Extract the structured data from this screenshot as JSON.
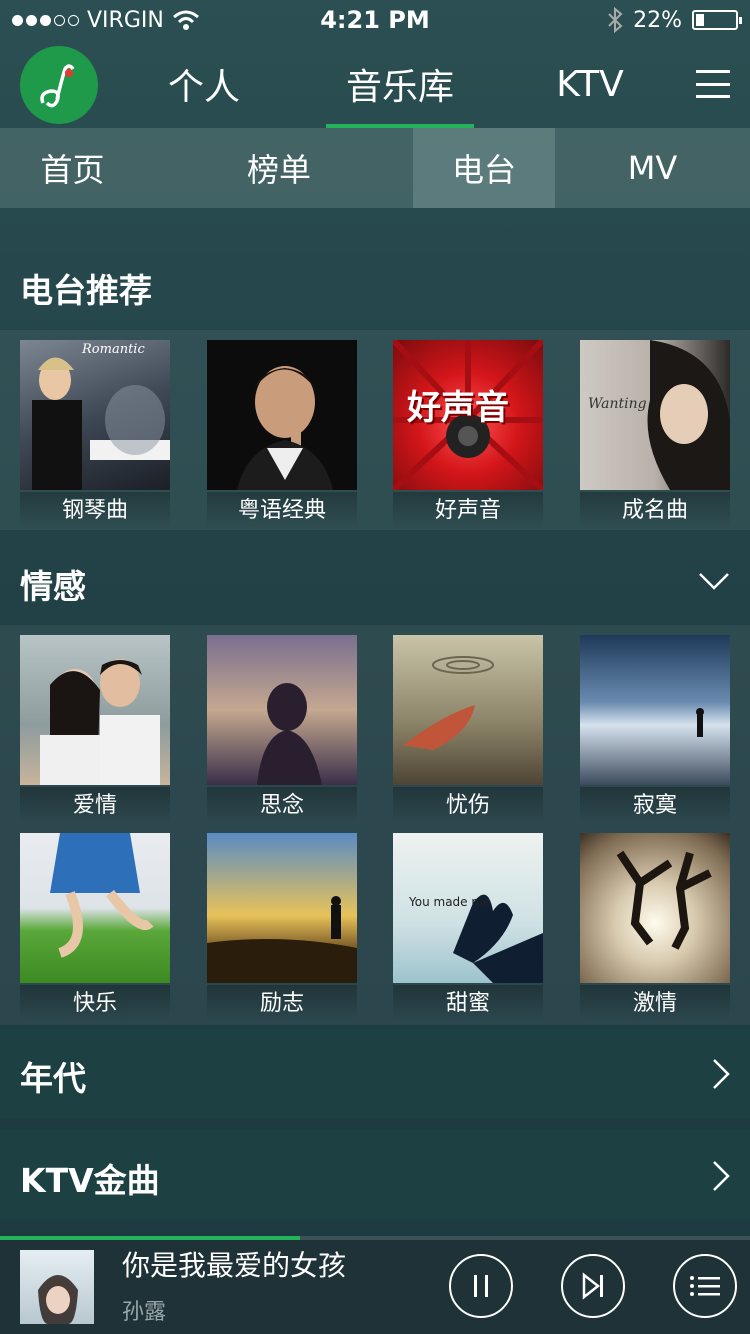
{
  "status": {
    "carrier": "VIRGIN",
    "time": "4:21 PM",
    "battery": "22%",
    "battery_level": 0.22
  },
  "top_nav": {
    "tabs": [
      "个人",
      "音乐库",
      "KTV"
    ],
    "active": 1
  },
  "sub_nav": {
    "tabs": [
      "首页",
      "榜单",
      "电台",
      "MV"
    ],
    "active": 2
  },
  "recommend": {
    "title": "电台推荐",
    "items": [
      {
        "label": "钢琴曲",
        "art_text": "Romantic"
      },
      {
        "label": "粤语经典"
      },
      {
        "label": "好声音",
        "art_text": "好声音"
      },
      {
        "label": "成名曲",
        "art_text": "Wanting"
      }
    ]
  },
  "emotion": {
    "title": "情感",
    "items": [
      {
        "label": "爱情"
      },
      {
        "label": "思念"
      },
      {
        "label": "忧伤"
      },
      {
        "label": "寂寞"
      },
      {
        "label": "快乐"
      },
      {
        "label": "励志"
      },
      {
        "label": "甜蜜",
        "art_text": "You made me"
      },
      {
        "label": "激情"
      }
    ]
  },
  "rows": [
    {
      "title": "年代"
    },
    {
      "title": "KTV金曲"
    }
  ],
  "player": {
    "song": "你是我最爱的女孩",
    "artist": "孙露",
    "progress": 0.4
  }
}
